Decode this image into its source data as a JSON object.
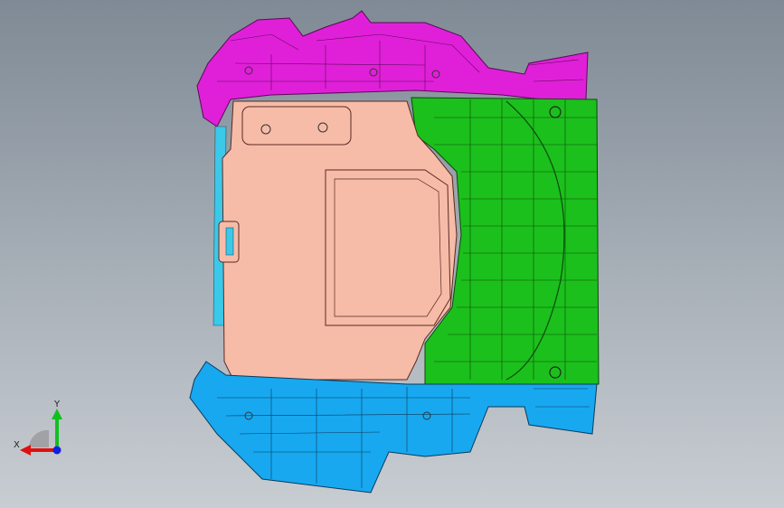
{
  "viewport": {
    "background_top": "#7f8a95",
    "background_bottom": "#c8cdd2"
  },
  "parts": [
    {
      "name": "upper-bracket",
      "color": "#e020d8"
    },
    {
      "name": "floor-panel",
      "color": "#f6bca8"
    },
    {
      "name": "rear-panel",
      "color": "#1cc01c"
    },
    {
      "name": "lower-bracket",
      "color": "#18a8f0"
    }
  ],
  "triad": {
    "x_label": "X",
    "y_label": "Y",
    "x_color": "#e01010",
    "y_color": "#10c020",
    "z_color": "#1020e0"
  }
}
